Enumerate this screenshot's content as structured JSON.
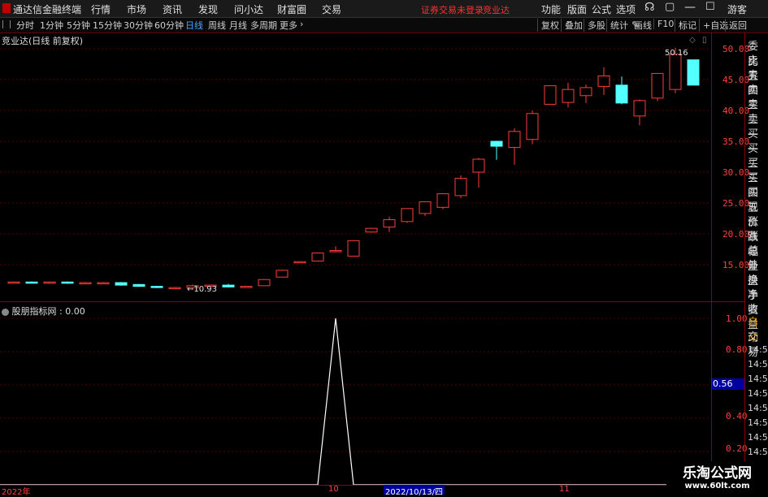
{
  "menubar": {
    "app_title": "通达信金融终端",
    "items": [
      "行情",
      "市场",
      "资讯",
      "发现",
      "问小达",
      "财富圈",
      "交易"
    ],
    "notice": "证券交易未登录",
    "notice_stock": "竞业达",
    "right_items": [
      "功能",
      "版面",
      "公式",
      "选项"
    ],
    "guest": "游客"
  },
  "toolbar": {
    "periods": [
      "分时",
      "1分钟",
      "5分钟",
      "15分钟",
      "30分钟",
      "60分钟",
      "日线",
      "周线",
      "月线",
      "多周期",
      "更多"
    ],
    "active_period": "日线",
    "right": [
      "复权",
      "叠加",
      "多股",
      "统计",
      "画线",
      "F10",
      "标记",
      "+自选",
      "返回"
    ]
  },
  "main_chart": {
    "title": "竞业达(日线 前复权)",
    "high_label": "50.16",
    "low_label": "10.93",
    "y_ticks": [
      "50.00",
      "45.00",
      "40.00",
      "35.00",
      "30.00",
      "25.00",
      "20.00",
      "15.00"
    ]
  },
  "indicator": {
    "title": "股朋指标网 : 0.00",
    "y_ticks": [
      "1.00",
      "0.80",
      "0.40",
      "0.20"
    ],
    "current_value": "0.56"
  },
  "x_axis": {
    "year_label": "2022年",
    "month_label_1": "10",
    "cursor_date": "2022/10/13/四",
    "month_label_2": "11"
  },
  "right_panel": {
    "labels": [
      "委比",
      "卖五",
      "卖四",
      "卖三",
      "卖二",
      "卖一",
      "买一",
      "买二",
      "买三",
      "买四",
      "买五",
      "现价",
      "涨跌",
      "涨幅",
      "总量",
      "外盘",
      "换手",
      "净资",
      "收益"
    ],
    "auto_label": "自动",
    "trade_label": "交易",
    "times": [
      "14:56",
      "14:56",
      "14:56",
      "14:56",
      "14:56",
      "14:56",
      "14:56",
      "14:56"
    ]
  },
  "watermark": {
    "title": "乐淘公式网",
    "url": "www.60lt.com"
  },
  "colors": {
    "up": "#ff3b3b",
    "down": "#54ffff",
    "grid": "#5a0000",
    "indicator_line": "#ffffff"
  },
  "chart_data": {
    "type": "candlestick",
    "candles": [
      {
        "o": 12.2,
        "c": 12.2,
        "h": 12.3,
        "l": 12.1
      },
      {
        "o": 12.2,
        "c": 12.1,
        "h": 12.3,
        "l": 12.0
      },
      {
        "o": 12.0,
        "c": 12.2,
        "h": 12.3,
        "l": 11.9
      },
      {
        "o": 12.2,
        "c": 12.0,
        "h": 12.3,
        "l": 11.9
      },
      {
        "o": 12.0,
        "c": 12.1,
        "h": 12.2,
        "l": 11.9
      },
      {
        "o": 12.1,
        "c": 12.1,
        "h": 12.2,
        "l": 12.0
      },
      {
        "o": 12.1,
        "c": 11.7,
        "h": 12.2,
        "l": 11.6
      },
      {
        "o": 11.8,
        "c": 11.5,
        "h": 11.9,
        "l": 11.4
      },
      {
        "o": 11.5,
        "c": 11.3,
        "h": 11.6,
        "l": 11.2
      },
      {
        "o": 11.2,
        "c": 11.3,
        "h": 11.4,
        "l": 11.1
      },
      {
        "o": 11.3,
        "c": 11.6,
        "h": 11.8,
        "l": 10.93
      },
      {
        "o": 11.6,
        "c": 11.7,
        "h": 11.8,
        "l": 11.5
      },
      {
        "o": 11.7,
        "c": 11.4,
        "h": 11.9,
        "l": 11.3
      },
      {
        "o": 11.4,
        "c": 11.5,
        "h": 11.6,
        "l": 11.3
      },
      {
        "o": 11.6,
        "c": 12.6,
        "h": 12.7,
        "l": 11.6
      },
      {
        "o": 13.0,
        "c": 14.1,
        "h": 14.2,
        "l": 13.0
      },
      {
        "o": 15.5,
        "c": 15.5,
        "h": 15.5,
        "l": 15.5
      },
      {
        "o": 15.6,
        "c": 16.9,
        "h": 17.0,
        "l": 15.6
      },
      {
        "o": 17.3,
        "c": 17.3,
        "h": 18.0,
        "l": 17.0
      },
      {
        "o": 16.4,
        "c": 18.9,
        "h": 18.9,
        "l": 16.4
      },
      {
        "o": 20.3,
        "c": 20.9,
        "h": 21.0,
        "l": 20.2
      },
      {
        "o": 21.1,
        "c": 22.3,
        "h": 22.8,
        "l": 20.3
      },
      {
        "o": 22.0,
        "c": 24.1,
        "h": 24.1,
        "l": 21.8
      },
      {
        "o": 23.3,
        "c": 25.2,
        "h": 25.3,
        "l": 22.9
      },
      {
        "o": 24.3,
        "c": 26.5,
        "h": 26.6,
        "l": 24.0
      },
      {
        "o": 26.2,
        "c": 29.0,
        "h": 29.5,
        "l": 25.8
      },
      {
        "o": 30.0,
        "c": 32.1,
        "h": 32.3,
        "l": 27.5
      },
      {
        "o": 35.0,
        "c": 34.2,
        "h": 35.1,
        "l": 32.0
      },
      {
        "o": 34.0,
        "c": 36.6,
        "h": 37.1,
        "l": 31.2
      },
      {
        "o": 35.3,
        "c": 39.5,
        "h": 40.0,
        "l": 34.5
      },
      {
        "o": 41.0,
        "c": 44.0,
        "h": 44.0,
        "l": 41.0
      },
      {
        "o": 41.3,
        "c": 43.4,
        "h": 44.5,
        "l": 40.5
      },
      {
        "o": 42.4,
        "c": 43.7,
        "h": 44.2,
        "l": 41.2
      },
      {
        "o": 43.9,
        "c": 45.6,
        "h": 47.0,
        "l": 42.5
      },
      {
        "o": 44.1,
        "c": 41.2,
        "h": 45.5,
        "l": 41.0
      },
      {
        "o": 39.1,
        "c": 41.6,
        "h": 41.8,
        "l": 37.6
      },
      {
        "o": 42.0,
        "c": 46.0,
        "h": 46.0,
        "l": 41.5
      },
      {
        "o": 43.4,
        "c": 49.1,
        "h": 50.16,
        "l": 42.8
      },
      {
        "o": 48.2,
        "c": 44.1,
        "h": 48.2,
        "l": 44.1
      }
    ],
    "y_range": [
      10.0,
      51.0
    ],
    "indicator_series": [
      0,
      0,
      0,
      0,
      0,
      0,
      0,
      0,
      0,
      0,
      0,
      0,
      0,
      0,
      0,
      0,
      0,
      0,
      1,
      0,
      0,
      0,
      0,
      0,
      0,
      0,
      0,
      0,
      0,
      0,
      0,
      0,
      0,
      0,
      0,
      0,
      0,
      0,
      0
    ],
    "indicator_y_range": [
      0,
      1.0
    ]
  }
}
